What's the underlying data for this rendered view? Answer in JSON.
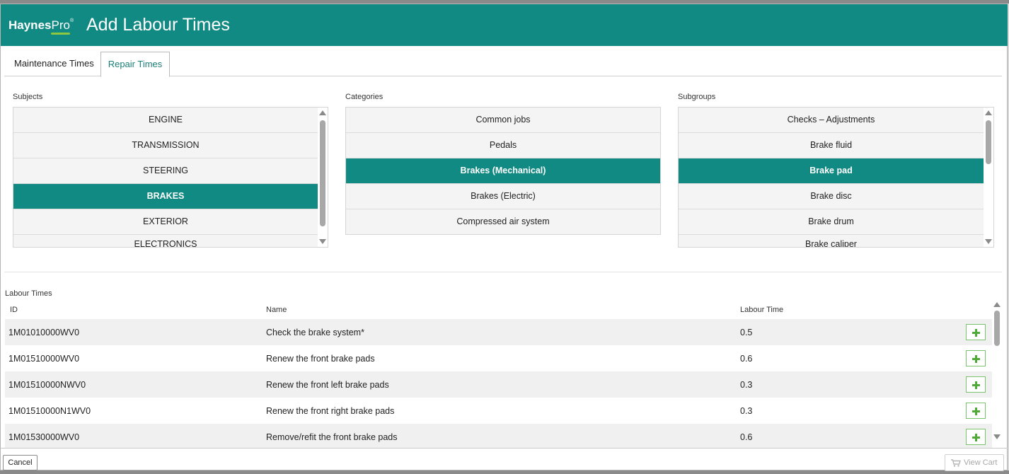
{
  "header": {
    "logo_main": "Haynes",
    "logo_pro": "Pro",
    "logo_reg": "®",
    "title": "Add Labour Times",
    "color": "#128a84"
  },
  "tabs": [
    {
      "label": "Maintenance Times",
      "active": false
    },
    {
      "label": "Repair Times",
      "active": true
    }
  ],
  "subjects": {
    "label": "Subjects",
    "items": [
      "ENGINE",
      "TRANSMISSION",
      "STEERING",
      "BRAKES",
      "EXTERIOR",
      "ELECTRONICS"
    ],
    "selected": "BRAKES"
  },
  "categories": {
    "label": "Categories",
    "items": [
      "Common jobs",
      "Pedals",
      "Brakes (Mechanical)",
      "Brakes (Electric)",
      "Compressed air system"
    ],
    "selected": "Brakes (Mechanical)"
  },
  "subgroups": {
    "label": "Subgroups",
    "items": [
      "Checks – Adjustments",
      "Brake fluid",
      "Brake pad",
      "Brake disc",
      "Brake drum",
      "Brake caliper"
    ],
    "selected": "Brake pad"
  },
  "labour_times": {
    "label": "Labour Times",
    "columns": {
      "id": "ID",
      "name": "Name",
      "time": "Labour Time"
    },
    "rows": [
      {
        "id": "1M01010000WV0",
        "name": "Check the brake system*",
        "time": "0.5"
      },
      {
        "id": "1M01510000WV0",
        "name": "Renew the front brake pads",
        "time": "0.6"
      },
      {
        "id": "1M01510000NWV0",
        "name": "Renew the front left brake pads",
        "time": "0.3"
      },
      {
        "id": "1M01510000N1WV0",
        "name": "Renew the front right brake pads",
        "time": "0.3"
      },
      {
        "id": "1M01530000WV0",
        "name": "Remove/refit the front brake pads",
        "time": "0.6"
      }
    ]
  },
  "footer": {
    "cancel_label": "Cancel",
    "view_cart_label": "View Cart"
  },
  "icons": {
    "add": "plus-icon",
    "cart": "cart-icon",
    "scroll_up": "arrow-up-icon",
    "scroll_down": "arrow-down-icon"
  }
}
